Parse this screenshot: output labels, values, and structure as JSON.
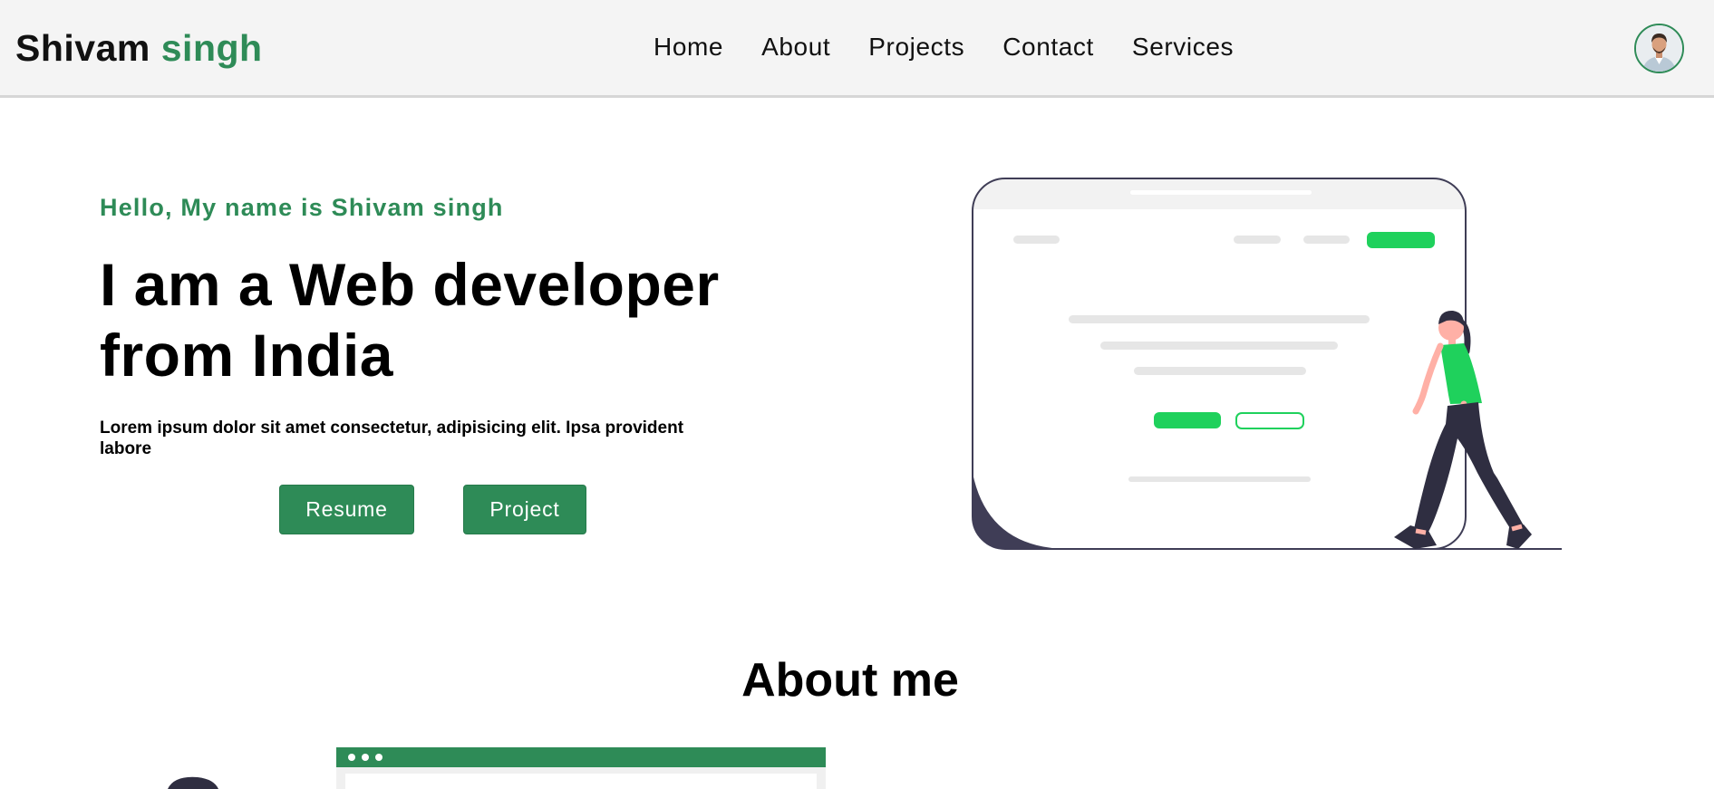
{
  "brand": {
    "first": "Shivam",
    "last": "singh"
  },
  "nav": {
    "items": [
      "Home",
      "About",
      "Projects",
      "Contact",
      "Services"
    ]
  },
  "hero": {
    "greeting": "Hello, My name is Shivam singh",
    "headline_line1": "I am a Web developer",
    "headline_line2": "from India",
    "description": "Lorem ipsum dolor sit amet consectetur, adipisicing elit. Ipsa provident labore",
    "buttons": {
      "resume": "Resume",
      "project": "Project"
    }
  },
  "about": {
    "title": "About me"
  },
  "colors": {
    "accent": "#2e8b57",
    "illustration_green": "#1fd15c",
    "dark": "#3f3d56",
    "navbar_bg": "#f4f4f4"
  },
  "icons": [
    "avatar-photo",
    "web-page-illustration",
    "walking-woman-illustration",
    "browser-window-illustration"
  ]
}
